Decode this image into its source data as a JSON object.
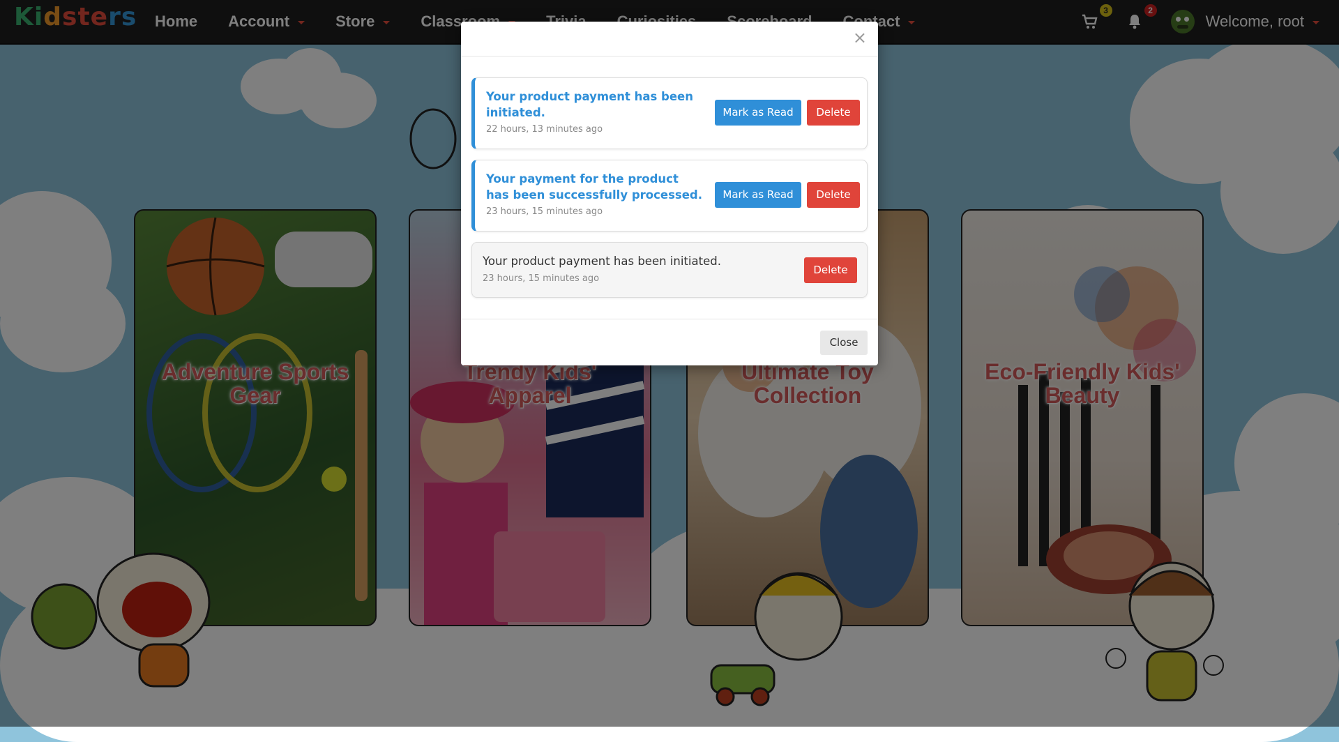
{
  "navbar": {
    "brand": {
      "parts": [
        "Ki",
        "d",
        "ste",
        "rs"
      ]
    },
    "items": [
      {
        "label": "Home",
        "dropdown": false
      },
      {
        "label": "Account",
        "dropdown": true
      },
      {
        "label": "Store",
        "dropdown": true
      },
      {
        "label": "Classroom",
        "dropdown": true
      },
      {
        "label": "Trivia",
        "dropdown": false
      },
      {
        "label": "Curiosities",
        "dropdown": false
      },
      {
        "label": "Scoreboard",
        "dropdown": false
      },
      {
        "label": "Contact",
        "dropdown": true
      }
    ],
    "cart_count": "3",
    "notification_count": "2",
    "welcome": "Welcome, root",
    "icons": {
      "cart": "cart-icon",
      "bell": "bell-icon",
      "avatar": "monster-avatar-icon"
    }
  },
  "categories": [
    {
      "title": "Adventure Sports Gear",
      "color": "#3f7a3a"
    },
    {
      "title": "Trendy Kids' Apparel",
      "color": "#d94a7a"
    },
    {
      "title": "Ultimate Toy Collection",
      "color": "#b89878"
    },
    {
      "title": "Eco-Friendly Kids' Beauty",
      "color": "#e8d8c8"
    }
  ],
  "modal": {
    "close_symbol": "×",
    "notifications": [
      {
        "text": "Your product payment has been initiated.",
        "time": "22 hours, 13 minutes ago",
        "unread": true,
        "mark_label": "Mark as Read",
        "delete_label": "Delete"
      },
      {
        "text": "Your payment for the product has been successfully processed.",
        "time": "23 hours, 15 minutes ago",
        "unread": true,
        "mark_label": "Mark as Read",
        "delete_label": "Delete"
      },
      {
        "text": "Your product payment has been initiated.",
        "time": "23 hours, 15 minutes ago",
        "unread": false,
        "delete_label": "Delete"
      }
    ],
    "close_label": "Close"
  },
  "colors": {
    "accent": "#2f8fd8",
    "danger": "#e0443a",
    "navbar": "#1e1e1e",
    "sky": "#8fc4dc"
  }
}
